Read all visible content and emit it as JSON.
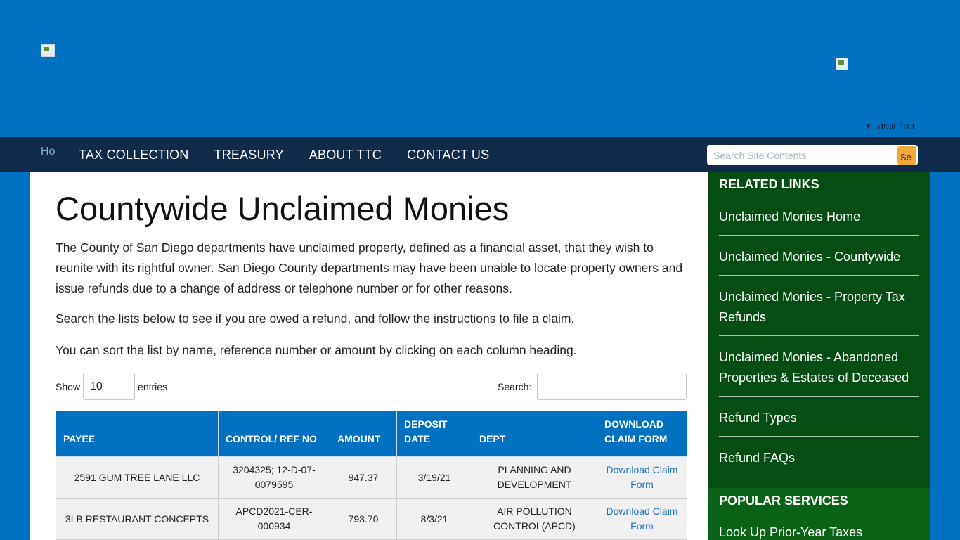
{
  "header": {
    "language_label": "בחר שפה",
    "language_arrow": "▼"
  },
  "nav": {
    "home_alt": "Ho",
    "items": [
      "TAX COLLECTION",
      "TREASURY",
      "ABOUT TTC",
      "CONTACT US"
    ],
    "search_placeholder": "Search Site Contents",
    "search_btn_alt": "Se"
  },
  "main": {
    "title": "Countywide Unclaimed Monies",
    "paragraphs": [
      "The County of San Diego departments have unclaimed property, defined as a financial asset, that they wish to reunite with its rightful owner. San Diego County departments may have been unable to locate property owners and issue refunds due to a change of address or telephone number or for other reasons.",
      "Search the lists below to see if you are owed a refund, and follow the instructions to file a claim.",
      "You can sort the list by name, reference number or amount by clicking on each column heading."
    ],
    "show_label": "Show",
    "show_value": "10",
    "entries_label": "entries",
    "search_label": "Search:",
    "table": {
      "headers": [
        "PAYEE",
        "CONTROL/ REF NO",
        "AMOUNT",
        "DEPOSIT DATE",
        "DEPT",
        "DOWNLOAD CLAIM FORM"
      ],
      "rows": [
        [
          "2591 GUM TREE LANE LLC",
          "3204325; 12-D-07-0079595",
          "947.37",
          "3/19/21",
          "PLANNING AND DEVELOPMENT",
          "Download Claim Form"
        ],
        [
          "3LB RESTAURANT CONCEPTS",
          "APCD2021-CER-000934",
          "793.70",
          "8/3/21",
          "AIR POLLUTION CONTROL(APCD)",
          "Download Claim Form"
        ]
      ]
    }
  },
  "sidebar": {
    "title": "RELATED LINKS",
    "items": [
      "Unclaimed Monies Home",
      "Unclaimed Monies - Countywide",
      "Unclaimed Monies - Property Tax Refunds",
      "Unclaimed Monies - Abandoned Properties & Estates of Deceased",
      "Refund Types",
      "Refund FAQs"
    ],
    "popular_title": "POPULAR SERVICES",
    "popular_items": [
      "Look Up Prior-Year Taxes"
    ]
  },
  "colors": {
    "header_blue": "#0070c0",
    "nav_navy": "#102a4a",
    "sidebar_green": "#064d14",
    "popular_green": "#0b6318",
    "search_button": "#f2a93b"
  }
}
